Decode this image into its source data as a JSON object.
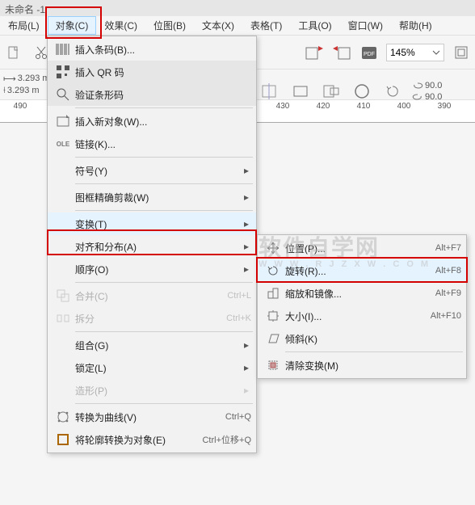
{
  "title": "未命名 -1",
  "menubar": {
    "layout": "布局(L)",
    "object": "对象(C)",
    "effects": "效果(C)",
    "bitmap": "位图(B)",
    "text": "文本(X)",
    "tables": "表格(T)",
    "tools": "工具(O)",
    "window": "窗口(W)",
    "help": "帮助(H)"
  },
  "toolbar": {
    "zoom": "145%"
  },
  "props": {
    "dim1": "3.293 m",
    "dim2": "3.293 m",
    "ang1": "90.0",
    "ang2": "90.0"
  },
  "ruler_labels": [
    "490",
    "430",
    "420",
    "410",
    "400",
    "390"
  ],
  "object_menu": {
    "insert_barcode": "插入条码(B)...",
    "insert_qr": "插入 QR 码",
    "validate_barcode": "验证条形码",
    "insert_new_obj": "插入新对象(W)...",
    "link": "链接(K)...",
    "symbol": "符号(Y)",
    "precise_crop": "图框精确剪裁(W)",
    "transform": "变换(T)",
    "align": "对齐和分布(A)",
    "order": "顺序(O)",
    "combine": "合并(C)",
    "combine_sc": "Ctrl+L",
    "split": "拆分",
    "split_sc": "Ctrl+K",
    "group": "组合(G)",
    "lock": "锁定(L)",
    "shape": "造形(P)",
    "to_curve": "转换为曲线(V)",
    "to_curve_sc": "Ctrl+Q",
    "outline_to_obj": "将轮廓转换为对象(E)",
    "outline_to_obj_sc": "Ctrl+位移+Q"
  },
  "transform_submenu": {
    "position": "位置(P)...",
    "position_sc": "Alt+F7",
    "rotate": "旋转(R)...",
    "rotate_sc": "Alt+F8",
    "scale": "缩放和镜像...",
    "scale_sc": "Alt+F9",
    "size": "大小(I)...",
    "size_sc": "Alt+F10",
    "skew": "倾斜(K)",
    "clear": "清除变换(M)"
  },
  "watermark": {
    "main": "软件自学网",
    "sub": "W W W . R J Z X W . C O M"
  }
}
